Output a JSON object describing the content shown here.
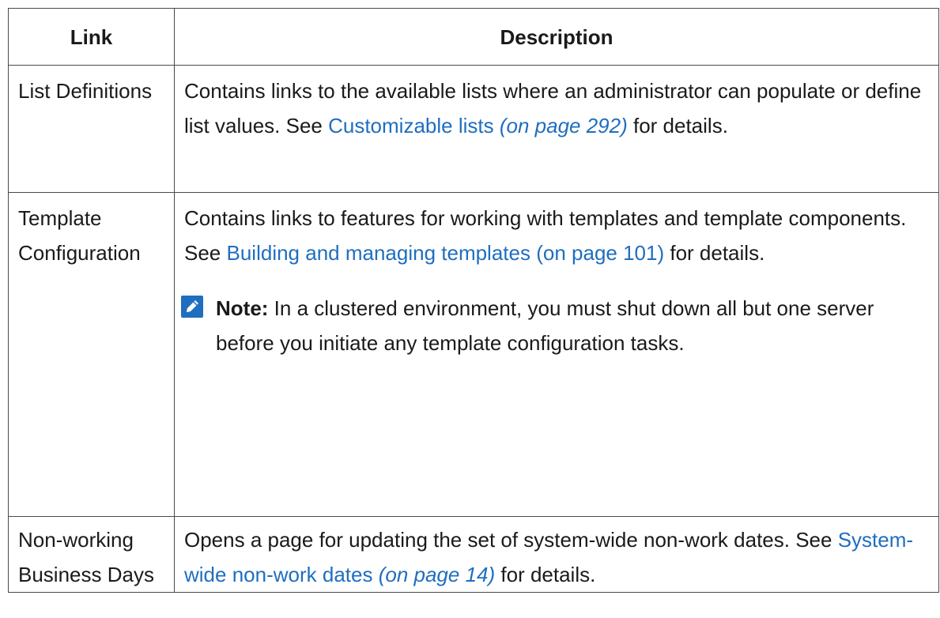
{
  "table": {
    "headers": {
      "link": "Link",
      "description": "Description"
    },
    "rows": [
      {
        "link_label": "List Definitions",
        "desc_before": "Contains links to the available lists where an administrator can populate or define list values. See ",
        "xref_label": "Customizable lists",
        "xref_page": "(on page 292)",
        "desc_after": " for details."
      },
      {
        "link_label": "Template Configuration",
        "desc_before": "Contains links to features for working with templates and template components. See ",
        "xref_label": "Building and managing templates",
        "xref_page": "(on page 101)",
        "desc_after": " for details.",
        "note": {
          "icon": "pencil-note-icon",
          "label": "Note:",
          "text": " In a clustered environment, you must shut down all but one server before you initiate any template configuration tasks."
        }
      },
      {
        "link_label": "Non-working Business Days",
        "desc_before": "Opens a page for updating the set of system-wide non-work dates. See ",
        "xref_label": "System-wide non-work dates",
        "xref_page": "(on page 14)",
        "desc_after": " for details."
      }
    ]
  },
  "colors": {
    "link": "#1f6ebf",
    "border": "#4a4a4a",
    "note_icon": "#1f6ebf"
  }
}
